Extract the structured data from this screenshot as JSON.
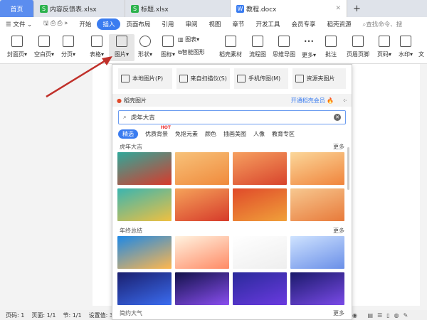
{
  "tabs": [
    {
      "label": "首页"
    },
    {
      "label": "内容反馈表.xlsx",
      "icon": "S"
    },
    {
      "label": "标题.xlsx",
      "icon": "S"
    },
    {
      "label": "教程.docx",
      "icon": "W"
    }
  ],
  "menu": {
    "file": "文件",
    "items": [
      "开始",
      "插入",
      "页面布局",
      "引用",
      "审阅",
      "视图",
      "章节",
      "开发工具",
      "会员专享",
      "稻壳资源"
    ],
    "active": "插入",
    "search": "查找命令、搜"
  },
  "toolbar": [
    "封面页",
    "空白页",
    "分页",
    "表格",
    "图片",
    "形状",
    "图标",
    "图表",
    "智能图形",
    "稻壳素材",
    "流程图",
    "思维导图",
    "更多",
    "批注",
    "页眉页脚",
    "页码",
    "水印",
    "文"
  ],
  "popup": {
    "sources": [
      "本地图片(P)",
      "来自扫描仪(S)",
      "手机传图(M)",
      "资源夹图片"
    ],
    "docer_label": "稻壳图片",
    "vip_label": "开通稻壳会员",
    "search_value": "虎年大吉",
    "categories": [
      "精选",
      "优质背景",
      "免抠元素",
      "颜色",
      "插画美图",
      "人像",
      "教育专区"
    ],
    "hot_badge": "HOT",
    "sections": [
      {
        "title": "虎年大吉",
        "more": "更多",
        "thumbs": [
          "#2fa89a,#d93a2b",
          "#f7c27a,#f08a3c",
          "#f6a060,#d8442c",
          "#fbd79a,#f0843c",
          "#3ab5b0,#f0c040",
          "#f5a35a,#d63a2a",
          "#e04a2a,#f0a03a",
          "#f7c890,#e87a3a"
        ]
      },
      {
        "title": "年终总结",
        "more": "更多",
        "thumbs": [
          "#1e88e5,#ffb74d",
          "#fff3e0,#ff8a65",
          "#ffffff,#eeeeee",
          "#cfe3ff,#6a8fe8",
          "#1a1f6e,#3b6cf0",
          "#12124a,#8a4ef0",
          "#2a2a9a,#6a3ae0",
          "#1a1a6a,#7a4ae8"
        ]
      },
      {
        "title": "简约大气",
        "more": "更多"
      }
    ]
  },
  "status": [
    "页码: 1",
    "页面: 1/1",
    "节: 1/1",
    "设置值: 3"
  ],
  "colors": {
    "accent": "#3a7cf0",
    "arrow": "#c0302a"
  }
}
